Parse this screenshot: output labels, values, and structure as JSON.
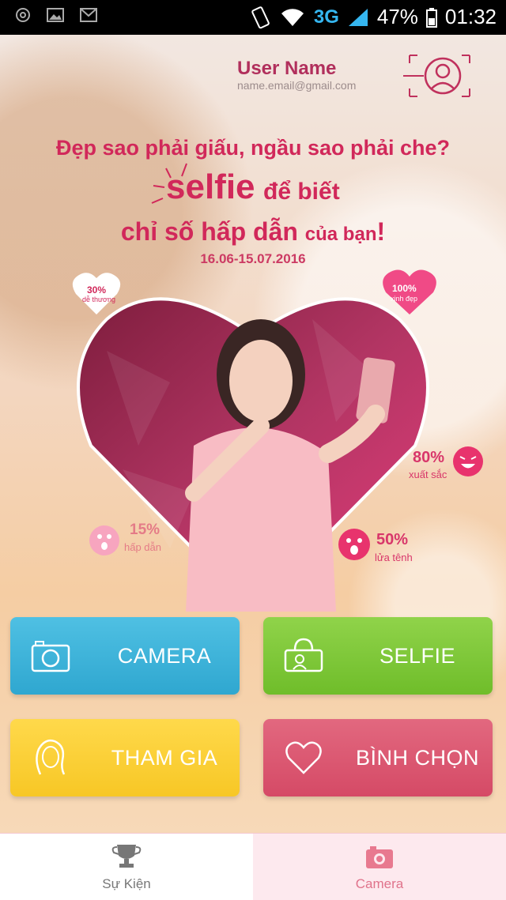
{
  "status_bar": {
    "network": "3G",
    "battery": "47%",
    "time": "01:32"
  },
  "header": {
    "user_name": "User Name",
    "email": "name.email@gmail.com"
  },
  "promo": {
    "line1": "Đẹp sao phải giấu, ngầu sao phải che?",
    "selfie": "selfie",
    "line2_rest": "để biết",
    "line3_main": "chỉ số hấp dẫn",
    "line3_small": "của bạn",
    "exclaim": "!",
    "dates": "16.06-15.07.2016"
  },
  "badges": [
    {
      "value": "30%",
      "label": "dễ thương"
    },
    {
      "value": "100%",
      "label": "xinh đẹp"
    }
  ],
  "stats": [
    {
      "value": "80%",
      "label": "xuất sắc"
    },
    {
      "value": "50%",
      "label": "lửa tênh"
    },
    {
      "value": "15%",
      "label": "hấp dẫn"
    }
  ],
  "buttons": {
    "camera": "CAMERA",
    "selfie": "SELFIE",
    "join": "THAM GIA",
    "vote": "BÌNH CHỌN"
  },
  "nav": {
    "events": "Sự Kiện",
    "camera": "Camera",
    "active": "camera"
  },
  "colors": {
    "brand_pink": "#d1285a",
    "camera_blue": "#3fb3db",
    "selfie_green": "#7fc83a",
    "join_yellow": "#fbd03a",
    "vote_pink": "#dc5a73"
  }
}
